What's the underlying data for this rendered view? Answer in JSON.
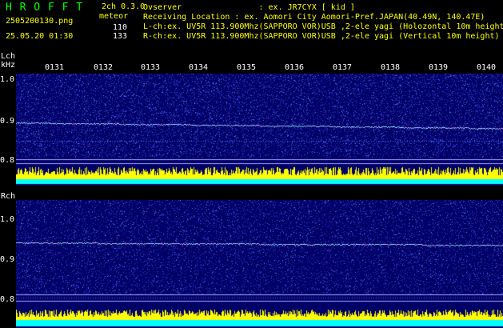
{
  "header": {
    "logo": "H R O F F T",
    "version": "2ch 0.3.0",
    "filename": "2505200130.png",
    "datetime": "25.05.20 01:30",
    "meteor_label": "meteor",
    "meteor_l": "110",
    "meteor_r": "133"
  },
  "station": {
    "observer": "Ovserver                : ex. JR7CYX [ kid ]",
    "location": "Receiving Location : ex. Aomori City Aomori-Pref.JAPAN(40.49N, 140.47E)",
    "lch": "L-ch:ex. UV5R 113.900Mhz(SAPPORO VOR)USB ,2-ele yagi (Holozontal 10m height)",
    "rch": "R-ch:ex. UV5R 113.900Mhz(SAPPORO VOR)USB ,2-ele yagi (Vertical 10m height)"
  },
  "lch_panel": {
    "label": "Lch",
    "unit": "kHz",
    "yticks": [
      "1.0",
      "0.9",
      "0.8"
    ]
  },
  "rch_panel": {
    "label": "Rch",
    "yticks": [
      "1.0",
      "0.9",
      "0.8"
    ]
  },
  "time_ticks": [
    "0131",
    "0132",
    "0133",
    "0134",
    "0135",
    "0136",
    "0137",
    "0138",
    "0139",
    "0140"
  ],
  "colors": {
    "background": "#000066",
    "header_text": "#00ff00",
    "level_bars": "#ffff00",
    "level_base": "#00ffff",
    "carrier": "#99ccff",
    "frame_line": "#aaaaff"
  }
}
